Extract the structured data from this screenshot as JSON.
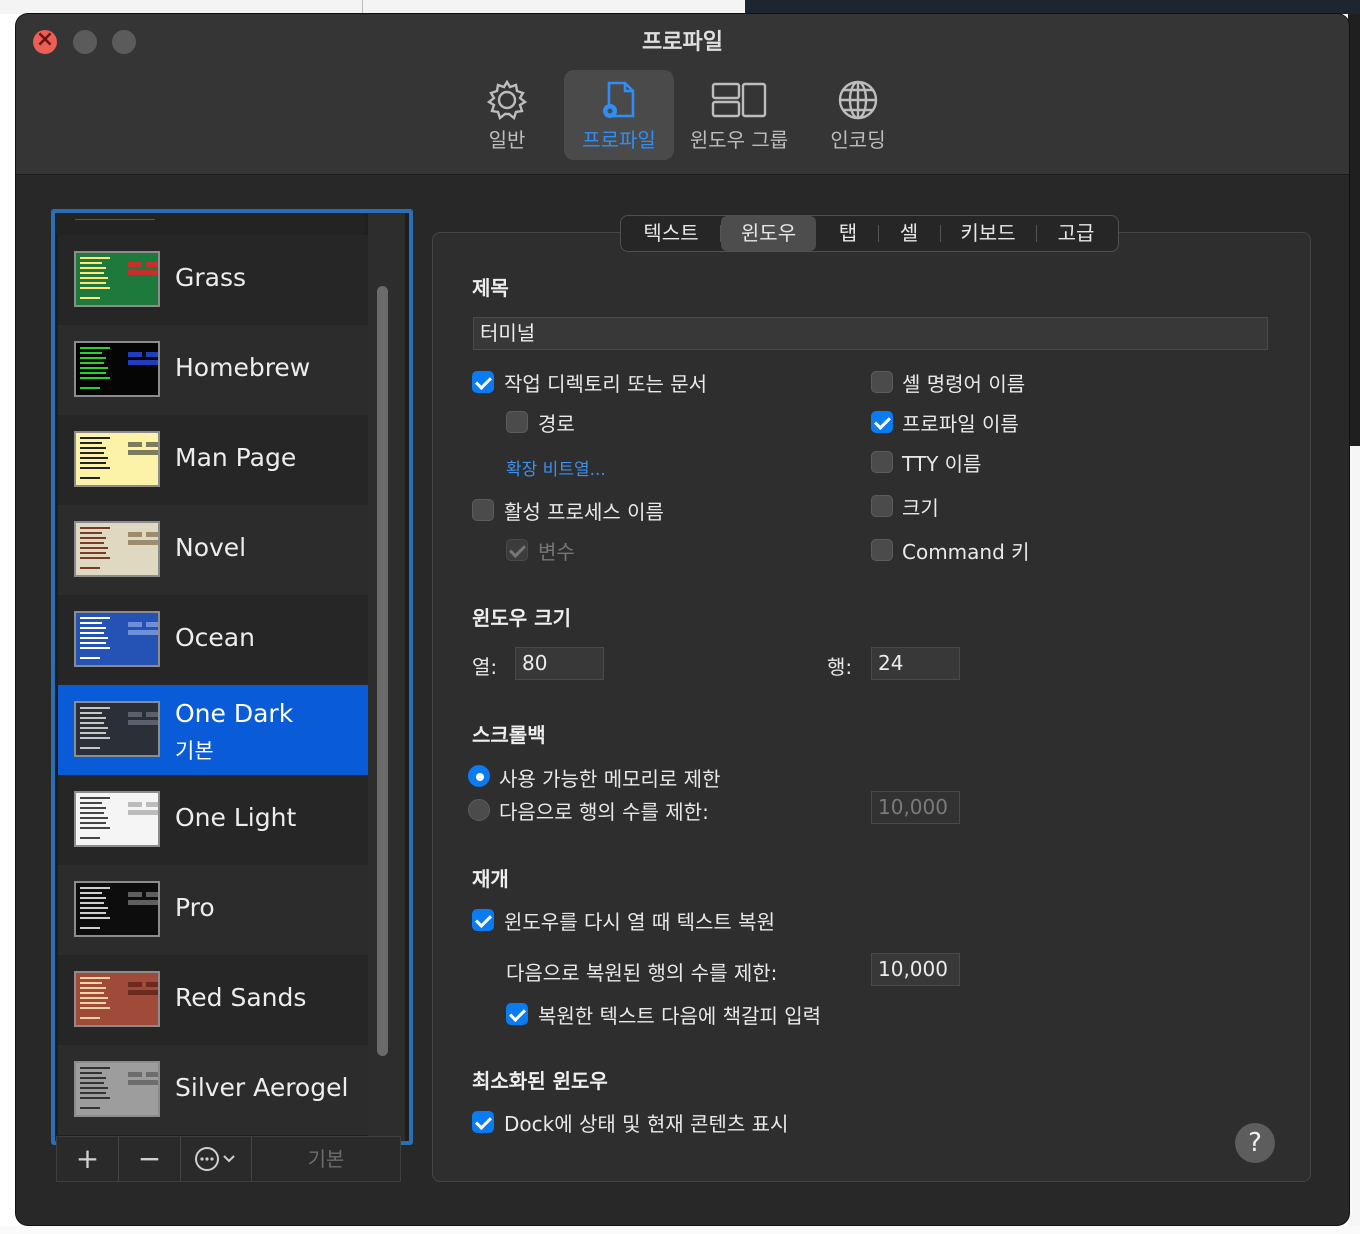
{
  "window": {
    "title": "프로파일"
  },
  "toolbar": {
    "items": [
      {
        "label": "일반",
        "icon": "gear-icon"
      },
      {
        "label": "프로파일",
        "icon": "profile-document-icon"
      },
      {
        "label": "윈도우 그룹",
        "icon": "window-groups-icon"
      },
      {
        "label": "인코딩",
        "icon": "globe-icon"
      }
    ],
    "active": "프로파일"
  },
  "profiles": {
    "items": [
      {
        "name": "Grass",
        "theme": {
          "bg": "#1e7a3c",
          "text": "#ffe57a",
          "hl": "#c5302a"
        }
      },
      {
        "name": "Homebrew",
        "theme": {
          "bg": "#050505",
          "text": "#2dd12d",
          "hl": "#1f3fbf"
        }
      },
      {
        "name": "Man Page",
        "theme": {
          "bg": "#fdf3a8",
          "text": "#222222",
          "hl": "#7c7c5c"
        }
      },
      {
        "name": "Novel",
        "theme": {
          "bg": "#dfd9c2",
          "text": "#7a3a2a",
          "hl": "#9c8c6c"
        }
      },
      {
        "name": "Ocean",
        "theme": {
          "bg": "#2452b5",
          "text": "#ffffff",
          "hl": "#6f8fd9"
        }
      },
      {
        "name": "One Dark",
        "sub": "기본",
        "theme": {
          "bg": "#2b2f38",
          "text": "#c6c6c6",
          "hl": "#5a5f6b"
        }
      },
      {
        "name": "One Light",
        "theme": {
          "bg": "#f5f5f5",
          "text": "#444444",
          "hl": "#bcbcbc"
        }
      },
      {
        "name": "Pro",
        "theme": {
          "bg": "#0d0d0d",
          "text": "#cfcfcf",
          "hl": "#5f5f5f"
        }
      },
      {
        "name": "Red Sands",
        "theme": {
          "bg": "#a04a3a",
          "text": "#f1d3a8",
          "hl": "#6b2a1e"
        }
      },
      {
        "name": "Silver Aerogel",
        "theme": {
          "bg": "#9d9d9d",
          "text": "#333333",
          "hl": "#6d6d6d"
        }
      }
    ],
    "selected": "One Dark",
    "buttons": {
      "add": "+",
      "remove": "−",
      "more": "⊙⌄",
      "default": "기본"
    }
  },
  "tabs": {
    "items": [
      "텍스트",
      "윈도우",
      "탭",
      "셀",
      "키보드",
      "고급"
    ],
    "active": "윈도우"
  },
  "title_section": {
    "heading": "제목",
    "value": "터미널",
    "working_dir": {
      "label": "작업 디렉토리 또는 문서",
      "checked": true
    },
    "path": {
      "label": "경로",
      "checked": false
    },
    "ext_link": "확장 비트열...",
    "active_process": {
      "label": "활성 프로세스 이름",
      "checked": false
    },
    "args": {
      "label": "변수",
      "checked": true,
      "disabled": true
    },
    "shell_cmd": {
      "label": "셸 명령어 이름",
      "checked": false
    },
    "profile_name": {
      "label": "프로파일 이름",
      "checked": true
    },
    "tty": {
      "label": "TTY 이름",
      "checked": false
    },
    "size": {
      "label": "크기",
      "checked": false
    },
    "command_key": {
      "label": "Command 키",
      "checked": false
    }
  },
  "window_size": {
    "heading": "윈도우 크기",
    "cols_label": "열:",
    "cols": "80",
    "rows_label": "행:",
    "rows": "24"
  },
  "scrollback": {
    "heading": "스크롤백",
    "limit_memory": {
      "label": "사용 가능한 메모리로 제한",
      "selected": true
    },
    "limit_rows": {
      "label": "다음으로 행의 수를 제한:",
      "selected": false,
      "value": "10,000"
    }
  },
  "resume": {
    "heading": "재개",
    "restore_text": {
      "label": "윈도우를 다시 열 때 텍스트 복원",
      "checked": true
    },
    "limit_label": "다음으로 복원된 행의 수를 제한:",
    "limit_value": "10,000",
    "bookmark": {
      "label": "복원한 텍스트 다음에 책갈피 입력",
      "checked": true
    }
  },
  "minimized": {
    "heading": "최소화된 윈도우",
    "dock_status": {
      "label": "Dock에 상태 및 현재 콘텐츠 표시",
      "checked": true
    }
  },
  "help": {
    "label": "?"
  }
}
